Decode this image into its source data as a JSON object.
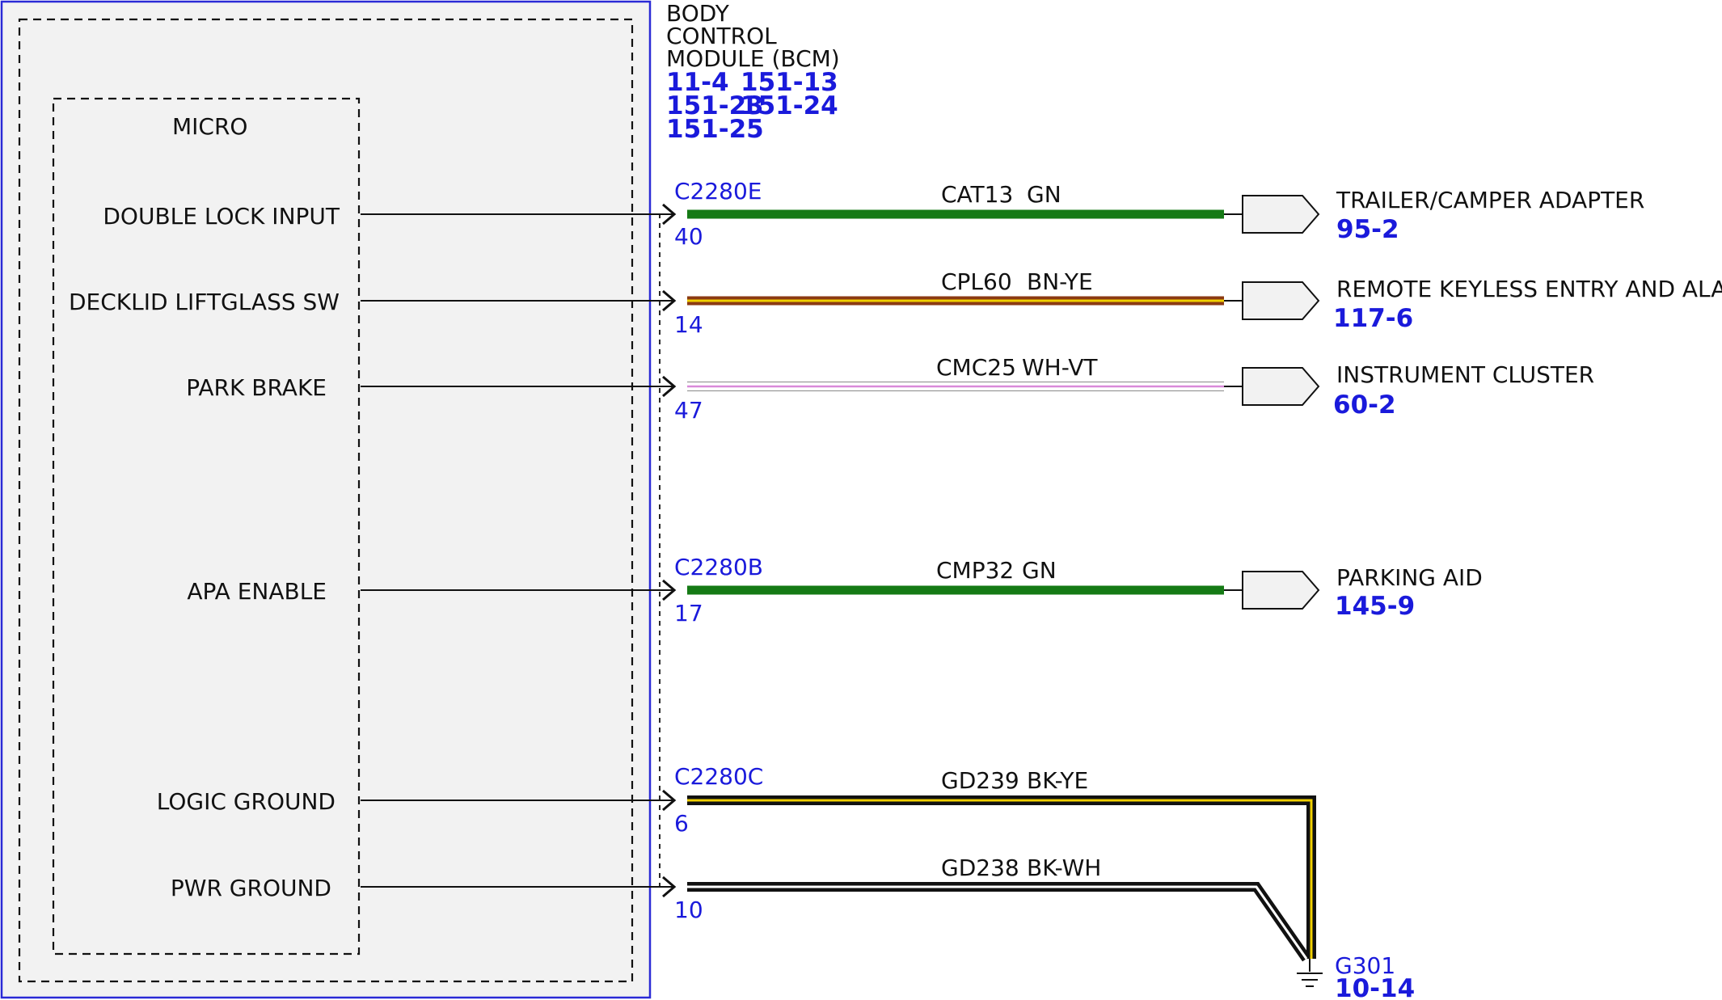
{
  "module": {
    "title_lines": [
      "BODY",
      "CONTROL",
      "MODULE (BCM)"
    ],
    "refs": [
      "11-4",
      "151-13",
      "151-23",
      "151-24",
      "151-25"
    ],
    "micro_label": "MICRO"
  },
  "colors": {
    "module_border": "#2a2ad6",
    "module_fill": "#f2f2f2",
    "label_blue": "#1a1adb"
  },
  "signals": [
    {
      "pin_label": "DOUBLE LOCK INPUT",
      "connector": "C2280E",
      "pin": "40",
      "circuit": "CAT13",
      "wire_color": "GN",
      "dest": "TRAILER/CAMPER ADAPTER",
      "dest_ref": "95-2"
    },
    {
      "pin_label": "DECKLID LIFTGLASS SW",
      "connector": "",
      "pin": "14",
      "circuit": "CPL60",
      "wire_color": "BN-YE",
      "dest": "REMOTE KEYLESS ENTRY AND ALARM",
      "dest_ref": "117-6"
    },
    {
      "pin_label": "PARK BRAKE",
      "connector": "",
      "pin": "47",
      "circuit": "CMC25",
      "wire_color": "WH-VT",
      "dest": "INSTRUMENT CLUSTER",
      "dest_ref": "60-2"
    },
    {
      "pin_label": "APA ENABLE",
      "connector": "C2280B",
      "pin": "17",
      "circuit": "CMP32",
      "wire_color": "GN",
      "dest": "PARKING AID",
      "dest_ref": "145-9"
    },
    {
      "pin_label": "LOGIC GROUND",
      "connector": "C2280C",
      "pin": "6",
      "circuit": "GD239",
      "wire_color": "BK-YE",
      "dest": "",
      "dest_ref": ""
    },
    {
      "pin_label": "PWR GROUND",
      "connector": "",
      "pin": "10",
      "circuit": "GD238",
      "wire_color": "BK-WH",
      "dest": "",
      "dest_ref": ""
    }
  ],
  "ground": {
    "name": "G301",
    "ref": "10-14"
  }
}
